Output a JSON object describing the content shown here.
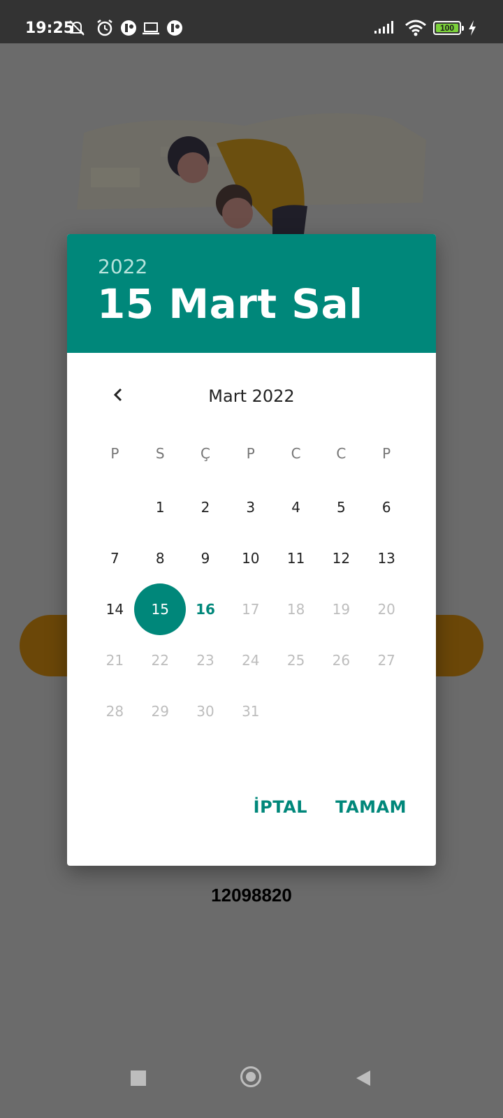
{
  "status_bar": {
    "time": "19:25",
    "battery_level": "100",
    "icons": [
      "notifications-muted-icon",
      "alarm-icon",
      "app-icon",
      "laptop-icon",
      "app-icon",
      "signal-icon",
      "wifi-icon",
      "battery-icon",
      "charging-icon"
    ]
  },
  "background": {
    "number": "12098820",
    "pill_color": "#6b4708"
  },
  "dialog": {
    "header": {
      "year": "2022",
      "date": "15 Mart Sal",
      "color": "#00877a"
    },
    "month_title": "Mart 2022",
    "weekdays": [
      "P",
      "S",
      "Ç",
      "P",
      "C",
      "C",
      "P"
    ],
    "weeks": [
      [
        "",
        "1",
        "2",
        "3",
        "4",
        "5",
        "6"
      ],
      [
        "7",
        "8",
        "9",
        "10",
        "11",
        "12",
        "13"
      ],
      [
        "14",
        "15",
        "16",
        "17",
        "18",
        "19",
        "20"
      ],
      [
        "21",
        "22",
        "23",
        "24",
        "25",
        "26",
        "27"
      ],
      [
        "28",
        "29",
        "30",
        "31",
        "",
        "",
        ""
      ]
    ],
    "selected_day": "15",
    "today_day": "16",
    "cancel_label": "İPTAL",
    "ok_label": "TAMAM"
  }
}
